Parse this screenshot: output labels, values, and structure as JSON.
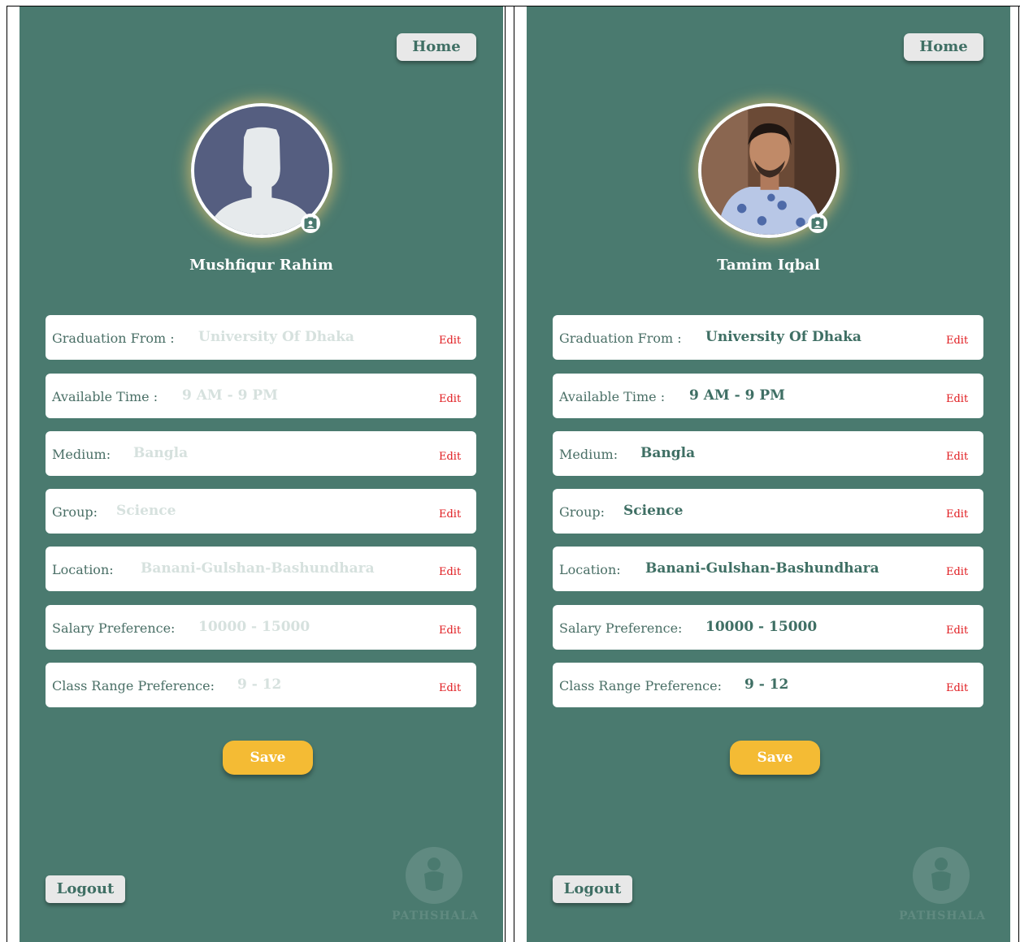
{
  "screens": [
    {
      "home_label": "Home",
      "name": "Mushfiqur Rahim",
      "avatar": "default-silhouette",
      "fields": [
        {
          "label": "Graduation From :",
          "value": "University Of  Dhaka",
          "edit": "Edit"
        },
        {
          "label": "Available Time :",
          "value": "9 AM - 9 PM",
          "edit": "Edit"
        },
        {
          "label": "Medium:",
          "value": "Bangla",
          "edit": "Edit"
        },
        {
          "label": "Group:",
          "value": "Science",
          "edit": "Edit"
        },
        {
          "label": "Location:",
          "value": "Banani-Gulshan-Bashundhara",
          "edit": "Edit"
        },
        {
          "label": "Salary Preference:",
          "value": "10000 - 15000",
          "edit": "Edit"
        },
        {
          "label": "Class Range Preference:",
          "value": "9 - 12",
          "edit": "Edit"
        }
      ],
      "save_label": "Save",
      "logout_label": "Logout",
      "watermark": "PATHSHALA"
    },
    {
      "home_label": "Home",
      "name": "Tamim Iqbal",
      "avatar": "profile-photo",
      "fields": [
        {
          "label": "Graduation From :",
          "value": "University Of  Dhaka",
          "edit": "Edit"
        },
        {
          "label": "Available Time :",
          "value": "9 AM - 9 PM",
          "edit": "Edit"
        },
        {
          "label": "Medium:",
          "value": "Bangla",
          "edit": "Edit"
        },
        {
          "label": "Group:",
          "value": "Science",
          "edit": "Edit"
        },
        {
          "label": "Location:",
          "value": "Banani-Gulshan-Bashundhara",
          "edit": "Edit"
        },
        {
          "label": "Salary Preference:",
          "value": "10000 - 15000",
          "edit": "Edit"
        },
        {
          "label": "Class Range Preference:",
          "value": "9 - 12",
          "edit": "Edit"
        }
      ],
      "save_label": "Save",
      "logout_label": "Logout",
      "watermark": "PATHSHALA"
    }
  ],
  "colors": {
    "screen_bg": "#4a7a6f",
    "button_light": "#e8e8e8",
    "save_button": "#f4bb34",
    "edit_link": "#e0191d",
    "value_placeholder": "#d6e1de",
    "value_filled": "#3f6f64"
  },
  "icons": [
    "contact-card-icon",
    "pathshala-logo"
  ]
}
